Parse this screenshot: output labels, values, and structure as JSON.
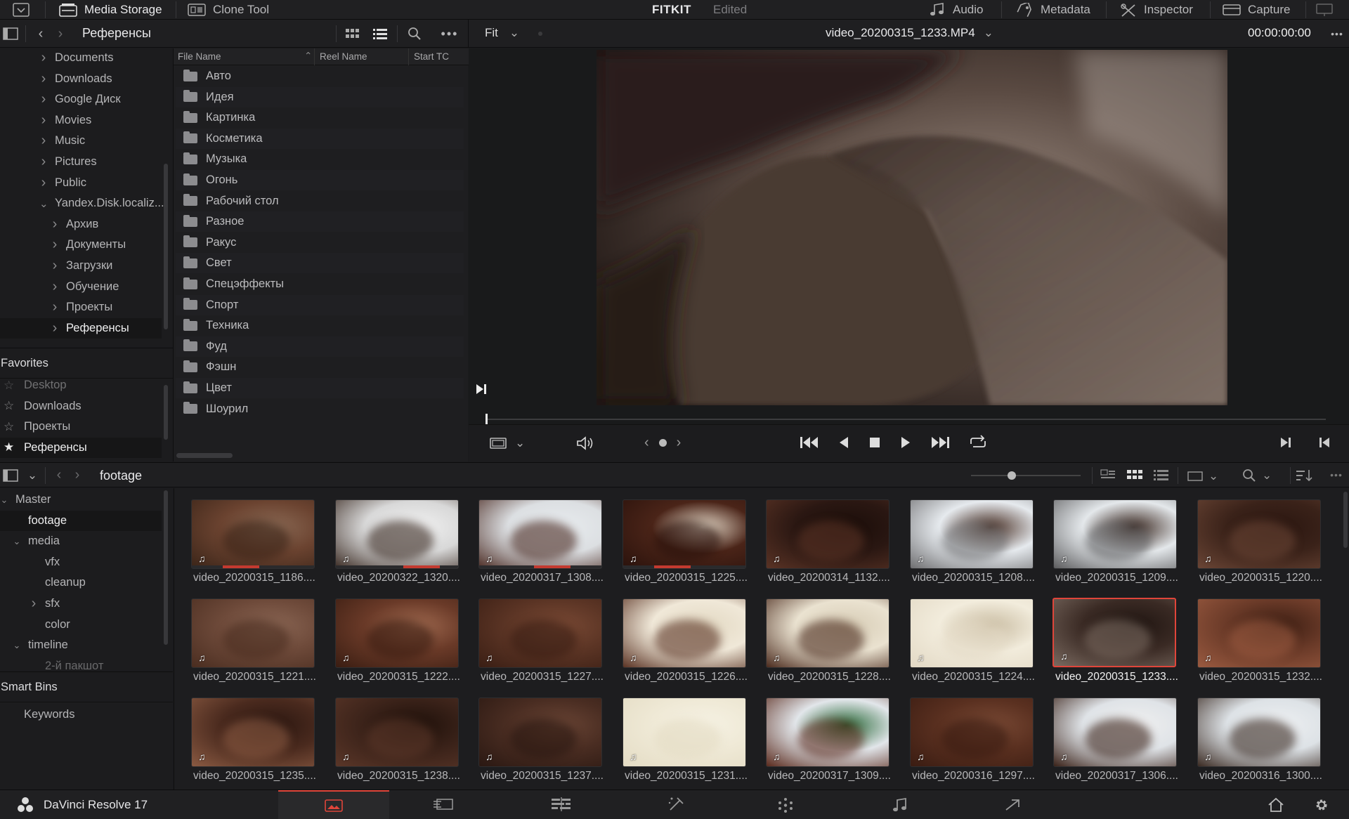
{
  "topbar": {
    "media_storage": "Media Storage",
    "clone_tool": "Clone Tool",
    "project_name": "FITKIT",
    "project_status": "Edited",
    "audio": "Audio",
    "metadata": "Metadata",
    "inspector": "Inspector",
    "capture": "Capture"
  },
  "browser": {
    "current_folder": "Референсы",
    "tree": [
      {
        "label": "Documents",
        "level": 1,
        "expanded": false
      },
      {
        "label": "Downloads",
        "level": 1,
        "expanded": false
      },
      {
        "label": "Google Диск",
        "level": 1,
        "expanded": false
      },
      {
        "label": "Movies",
        "level": 1,
        "expanded": false
      },
      {
        "label": "Music",
        "level": 1,
        "expanded": false
      },
      {
        "label": "Pictures",
        "level": 1,
        "expanded": false
      },
      {
        "label": "Public",
        "level": 1,
        "expanded": false
      },
      {
        "label": "Yandex.Disk.localiz...",
        "level": 1,
        "expanded": true
      },
      {
        "label": "Архив",
        "level": 2,
        "expanded": false
      },
      {
        "label": "Документы",
        "level": 2,
        "expanded": false
      },
      {
        "label": "Загрузки",
        "level": 2,
        "expanded": false
      },
      {
        "label": "Обучение",
        "level": 2,
        "expanded": false
      },
      {
        "label": "Проекты",
        "level": 2,
        "expanded": false
      },
      {
        "label": "Референсы",
        "level": 2,
        "expanded": false,
        "selected": true
      }
    ],
    "favorites_title": "Favorites",
    "favorites": [
      "Desktop",
      "Downloads",
      "Проекты",
      "Референсы"
    ],
    "columns": [
      "File Name",
      "Reel Name",
      "Start TC"
    ],
    "files": [
      "Авто",
      "Идея",
      "Картинка",
      "Косметика",
      "Музыка",
      "Огонь",
      "Рабочий стол",
      "Разное",
      "Ракус",
      "Свет",
      "Спецэффекты",
      "Спорт",
      "Техника",
      "Фуд",
      "Фэшн",
      "Цвет",
      "Шоурил"
    ]
  },
  "viewer": {
    "zoom": "Fit",
    "clip_name": "video_20200315_1233.MP4",
    "timecode": "00:00:00:00",
    "playhead_position": 0.0
  },
  "media_pool": {
    "current_bin": "footage",
    "bins": [
      {
        "label": "Master",
        "level": 0,
        "expanded": true
      },
      {
        "label": "footage",
        "level": 1,
        "selected": true
      },
      {
        "label": "media",
        "level": 1,
        "expanded": true
      },
      {
        "label": "vfx",
        "level": 2
      },
      {
        "label": "cleanup",
        "level": 2
      },
      {
        "label": "sfx",
        "level": 2,
        "collapsed": true
      },
      {
        "label": "color",
        "level": 2
      },
      {
        "label": "timeline",
        "level": 1,
        "expanded": true
      },
      {
        "label": "2-й пакшот",
        "level": 2
      }
    ],
    "smart_bins_title": "Smart Bins",
    "smart_bins": [
      "Keywords"
    ],
    "clips": [
      {
        "name": "video_20200315_1186....",
        "c1": "#6b4330",
        "c2": "#3a2418",
        "c3": "#8b6a55",
        "progress": 0.4
      },
      {
        "name": "video_20200322_1320....",
        "c1": "#d8d8d8",
        "c2": "#3a2a22",
        "c3": "#f2f2f2",
        "progress": 0.7
      },
      {
        "name": "video_20200317_1308....",
        "c1": "#dcdfe2",
        "c2": "#4a2a22",
        "c3": "#e8ecef",
        "progress": 0.6
      },
      {
        "name": "video_20200315_1225....",
        "c1": "#4a2418",
        "c2": "#2a120c",
        "c3": "#e8dccb",
        "progress": 0.4
      },
      {
        "name": "video_20200314_1132....",
        "c1": "#2a1712",
        "c2": "#5a3325",
        "c3": "#1a0d09"
      },
      {
        "name": "video_20200315_1208....",
        "c1": "#e6eaee",
        "c2": "#6e6e70",
        "c3": "#4a3025"
      },
      {
        "name": "video_20200315_1209....",
        "c1": "#e4e8eb",
        "c2": "#5c5c5e",
        "c3": "#3d2a22"
      },
      {
        "name": "video_20200315_1220....",
        "c1": "#3a2219",
        "c2": "#6a4535",
        "c3": "#2a1610"
      },
      {
        "name": "video_20200315_1221....",
        "c1": "#6e4a3a",
        "c2": "#4a2d20",
        "c3": "#8a6654"
      },
      {
        "name": "video_20200315_1222....",
        "c1": "#6a3a28",
        "c2": "#3a1d12",
        "c3": "#a06a50"
      },
      {
        "name": "video_20200315_1227....",
        "c1": "#5c3525",
        "c2": "#3a1e14",
        "c3": "#7a4a35"
      },
      {
        "name": "video_20200315_1226....",
        "c1": "#f0e8d8",
        "c2": "#5a3324",
        "c3": "#e2d8c2"
      },
      {
        "name": "video_20200315_1228....",
        "c1": "#eae2d0",
        "c2": "#4a2a1d",
        "c3": "#d6cbb4"
      },
      {
        "name": "video_20200315_1224....",
        "c1": "#f2ecdc",
        "c2": "#e2d8c4",
        "c3": "#c9bca2"
      },
      {
        "name": "video_20200315_1233....",
        "c1": "#3a2a24",
        "c2": "#7a6a60",
        "c3": "#1e1410",
        "selected": true
      },
      {
        "name": "video_20200315_1232....",
        "c1": "#6a3a28",
        "c2": "#9a5a40",
        "c3": "#3a1d12"
      },
      {
        "name": "video_20200315_1235....",
        "c1": "#4a2a1e",
        "c2": "#8a5a42",
        "c3": "#2a1610"
      },
      {
        "name": "video_20200315_1238....",
        "c1": "#3a2219",
        "c2": "#5a3628",
        "c3": "#1e100a"
      },
      {
        "name": "video_20200315_1237....",
        "c1": "#4a2d22",
        "c2": "#2a1812",
        "c3": "#6a4535"
      },
      {
        "name": "video_20200315_1231....",
        "c1": "#efe9d6",
        "c2": "#e4dcc4",
        "c3": "#f6f2e4"
      },
      {
        "name": "video_20200317_1309....",
        "c1": "#e2e6ea",
        "c2": "#5a2a1d",
        "c3": "#2a6a3a"
      },
      {
        "name": "video_20200316_1297....",
        "c1": "#5a3020",
        "c2": "#3a1c12",
        "c3": "#7a4a35"
      },
      {
        "name": "video_20200317_1306....",
        "c1": "#dfe3e7",
        "c2": "#3a2219",
        "c3": "#f0f0f0"
      },
      {
        "name": "video_20200316_1300....",
        "c1": "#dde2e6",
        "c2": "#3a2a22",
        "c3": "#eef0f2"
      }
    ]
  },
  "app": {
    "name": "DaVinci Resolve 17"
  },
  "pages": [
    {
      "icon": "media-page-icon",
      "active": true
    },
    {
      "icon": "cut-page-icon"
    },
    {
      "icon": "edit-page-icon"
    },
    {
      "icon": "fusion-page-icon"
    },
    {
      "icon": "color-page-icon"
    },
    {
      "icon": "fairlight-page-icon"
    },
    {
      "icon": "deliver-page-icon"
    }
  ],
  "colors": {
    "accent": "#e0453a",
    "panel": "#1c1c1e",
    "header": "#202022"
  }
}
